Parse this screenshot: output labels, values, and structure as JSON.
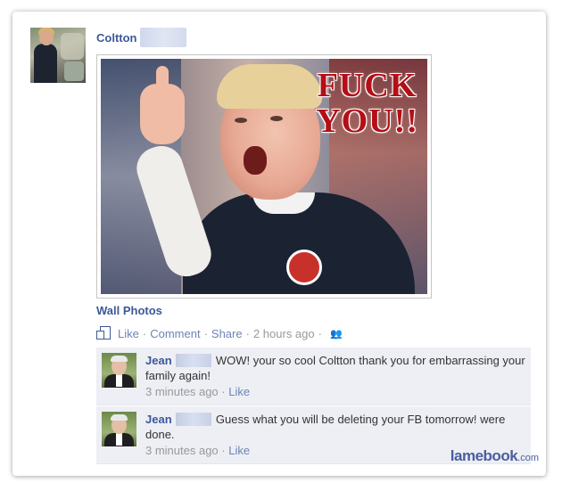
{
  "post": {
    "author": "Coltton",
    "image_overlay_text": [
      "FUCK",
      "YOU!!"
    ],
    "album_link": "Wall Photos",
    "actions": {
      "like": "Like",
      "comment": "Comment",
      "share": "Share",
      "timestamp": "2 hours ago"
    }
  },
  "comments": [
    {
      "author": "Jean",
      "text": "WOW! your so cool Coltton thank you for embarrassing your family again!",
      "time": "3 minutes ago",
      "like": "Like"
    },
    {
      "author": "Jean",
      "text": "Guess what you will be deleting your FB tomorrow! were done.",
      "time": "3 minutes ago",
      "like": "Like"
    }
  ],
  "watermark": {
    "brand": "lamebook",
    "suffix": ".com"
  },
  "colors": {
    "link": "#3b5998",
    "action_link": "#6d84b4",
    "comment_bg": "#edeff4",
    "overlay_text": "#b40f16"
  },
  "icons": [
    "photo-icon",
    "friends-privacy-icon"
  ]
}
